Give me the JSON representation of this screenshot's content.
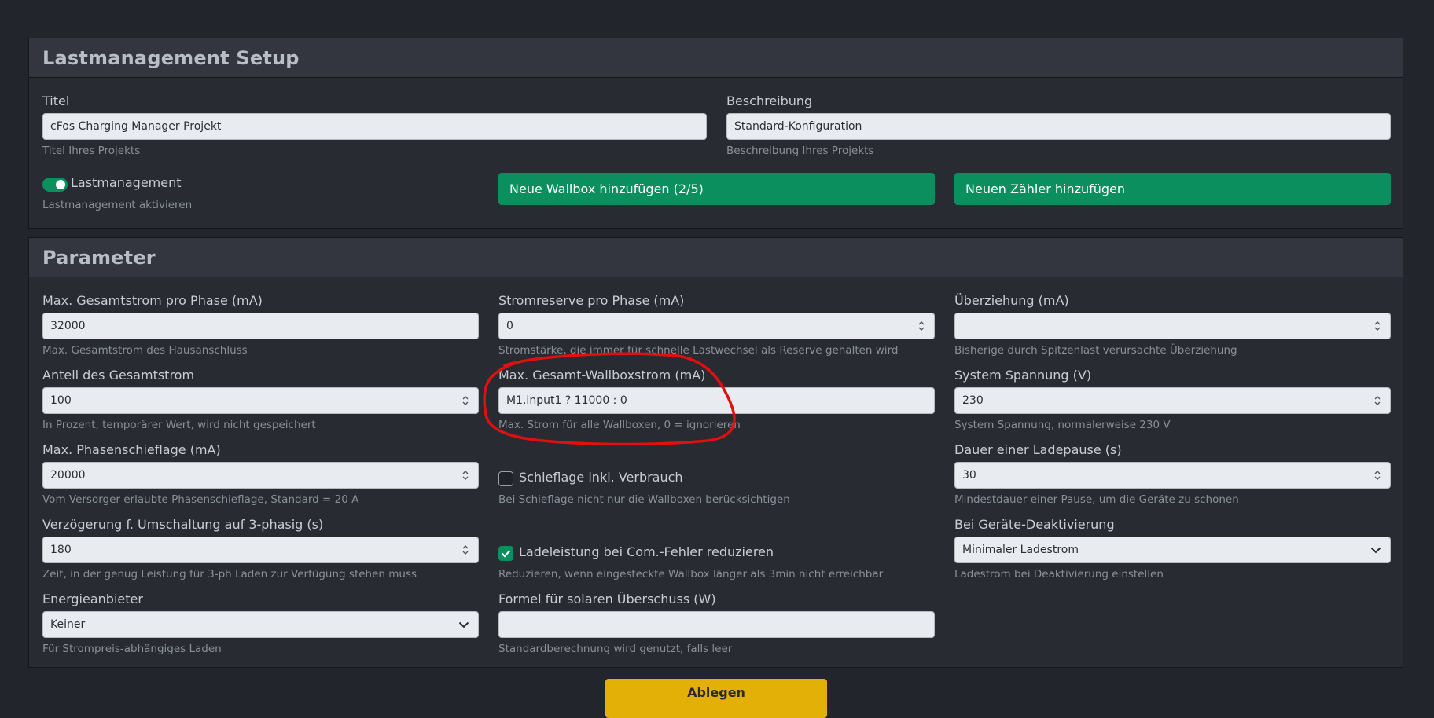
{
  "setup": {
    "title": "Lastmanagement Setup",
    "titel_label": "Titel",
    "titel_value": "cFos Charging Manager Projekt",
    "titel_help": "Titel Ihres Projekts",
    "beschreibung_label": "Beschreibung",
    "beschreibung_value": "Standard-Konfiguration",
    "beschreibung_help": "Beschreibung Ihres Projekts",
    "lastmanagement_label": "Lastmanagement",
    "lastmanagement_help": "Lastmanagement aktivieren",
    "lastmanagement_enabled": true,
    "add_wallbox_label": "Neue Wallbox hinzufügen (2/5)",
    "add_meter_label": "Neuen Zähler hinzufügen"
  },
  "parameter": {
    "title": "Parameter",
    "max_gesamtstrom": {
      "label": "Max. Gesamtstrom pro Phase (mA)",
      "value": "32000",
      "help": "Max. Gesamtstrom des Hausanschluss"
    },
    "stromreserve": {
      "label": "Stromreserve pro Phase (mA)",
      "value": "0",
      "help": "Stromstärke, die immer für schnelle Lastwechsel als Reserve gehalten wird"
    },
    "ueberziehung": {
      "label": "Überziehung (mA)",
      "value": "",
      "help": "Bisherige durch Spitzenlast verursachte Überziehung"
    },
    "anteil_gesamtstrom": {
      "label": "Anteil des Gesamtstrom",
      "value": "100",
      "help": "In Prozent, temporärer Wert, wird nicht gespeichert"
    },
    "max_wallboxstrom": {
      "label": "Max. Gesamt-Wallboxstrom (mA)",
      "value": "M1.input1 ? 11000 : 0",
      "help": "Max. Strom für alle Wallboxen, 0 = ignorieren"
    },
    "system_spannung": {
      "label": "System Spannung (V)",
      "value": "230",
      "help": "System Spannung, normalerweise 230 V"
    },
    "phasenschieflage": {
      "label": "Max. Phasenschieflage (mA)",
      "value": "20000",
      "help": "Vom Versorger erlaubte Phasenschieflage, Standard = 20 A"
    },
    "schieflage_verbrauch": {
      "label": "Schieflage inkl. Verbrauch",
      "checked": false,
      "help": "Bei Schieflage nicht nur die Wallboxen berücksichtigen"
    },
    "ladepause": {
      "label": "Dauer einer Ladepause (s)",
      "value": "30",
      "help": "Mindestdauer einer Pause, um die Geräte zu schonen"
    },
    "verzoegerung": {
      "label": "Verzögerung f. Umschaltung auf 3-phasig (s)",
      "value": "180",
      "help": "Zeit, in der genug Leistung für 3-ph Laden zur Verfügung stehen muss"
    },
    "ladeleistung_com": {
      "label": "Ladeleistung bei Com.-Fehler reduzieren",
      "checked": true,
      "help": "Reduzieren, wenn eingesteckte Wallbox länger als 3min nicht erreichbar"
    },
    "deaktivierung": {
      "label": "Bei Geräte-Deaktivierung",
      "value": "Minimaler Ladestrom",
      "help": "Ladestrom bei Deaktivierung einstellen"
    },
    "energieanbieter": {
      "label": "Energieanbieter",
      "value": "Keiner",
      "help": "Für Strompreis-abhängiges Laden"
    },
    "formel_ueberschuss": {
      "label": "Formel für solaren Überschuss (W)",
      "value": "",
      "help": "Standardberechnung wird genutzt, falls leer"
    }
  },
  "footer": {
    "save_label": "Ablegen"
  },
  "annotation": {
    "color": "#e01010"
  }
}
